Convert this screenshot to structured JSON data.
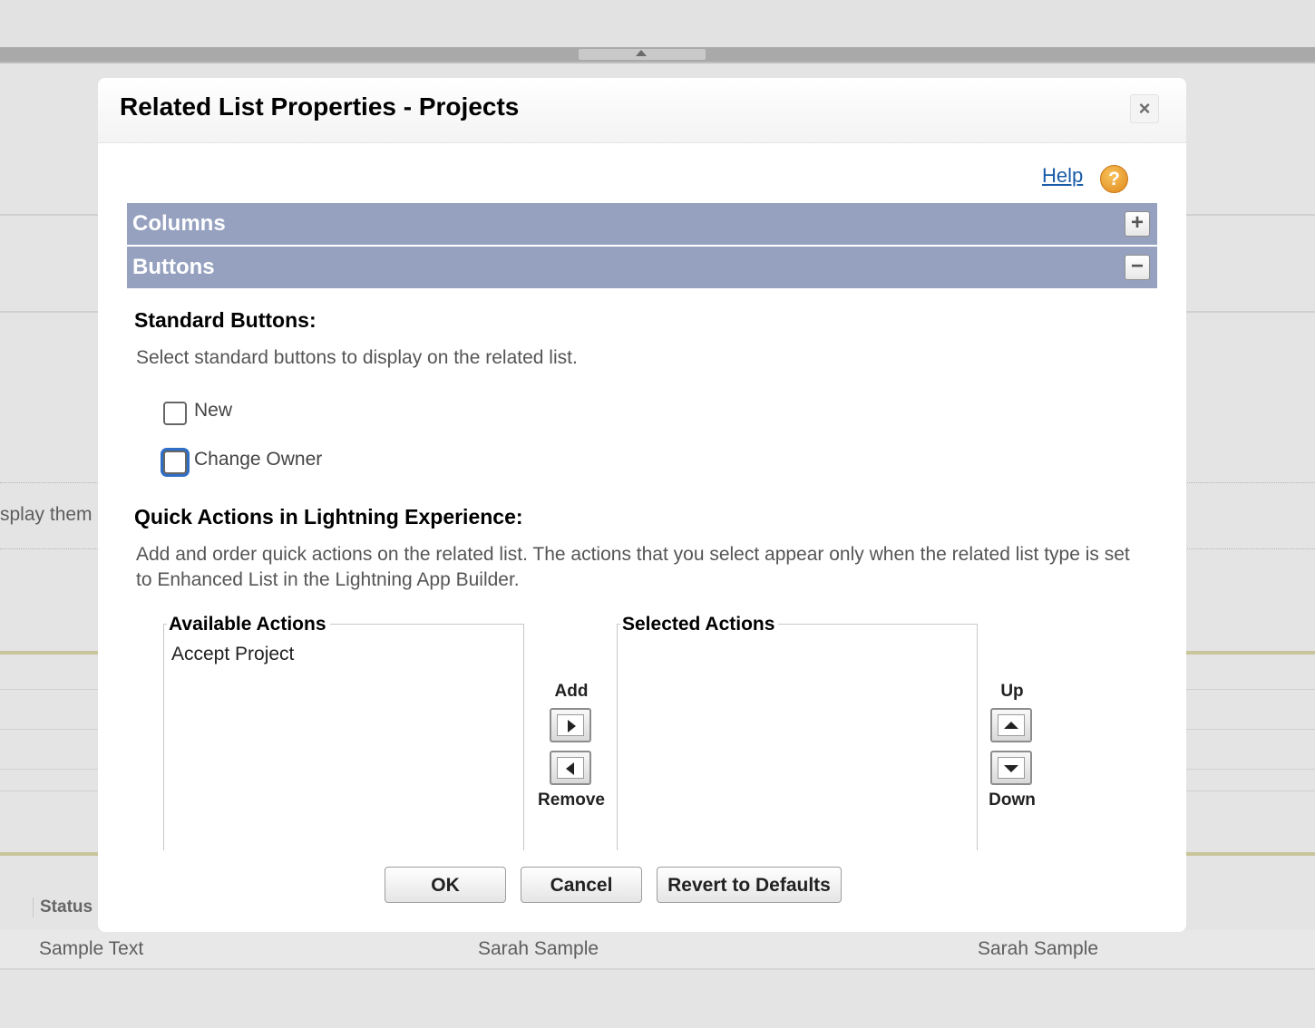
{
  "background": {
    "partial_text": "splay them",
    "status_column": "Status",
    "row": [
      "Sample Text",
      "Sarah Sample",
      "Sarah Sample"
    ]
  },
  "dialog": {
    "title": "Related List Properties - Projects",
    "close_label": "×",
    "help_label": "Help",
    "help_icon_glyph": "?",
    "sections": {
      "columns": {
        "label": "Columns",
        "toggle": "+"
      },
      "buttons": {
        "label": "Buttons",
        "toggle": "−"
      }
    },
    "standard_buttons": {
      "heading": "Standard Buttons:",
      "description": "Select standard buttons to display on the related list.",
      "options": [
        {
          "label": "New",
          "checked": false
        },
        {
          "label": "Change Owner",
          "checked": false
        }
      ]
    },
    "quick_actions": {
      "heading": "Quick Actions in Lightning Experience:",
      "description": "Add and order quick actions on the related list. The actions that you select appear only when the related list type is set to Enhanced List in the Lightning App Builder.",
      "available_label": "Available Actions",
      "available_items": [
        "Accept Project"
      ],
      "selected_label": "Selected Actions",
      "selected_items": [],
      "add_label": "Add",
      "remove_label": "Remove",
      "up_label": "Up",
      "down_label": "Down"
    },
    "footer": {
      "ok_label": "OK",
      "cancel_label": "Cancel",
      "revert_label": "Revert to Defaults"
    }
  },
  "colors": {
    "section_bar": "#95a1bf",
    "link": "#1a5ca8",
    "focus_ring": "#2f6ec7",
    "help_icon": "#e89a2a"
  }
}
